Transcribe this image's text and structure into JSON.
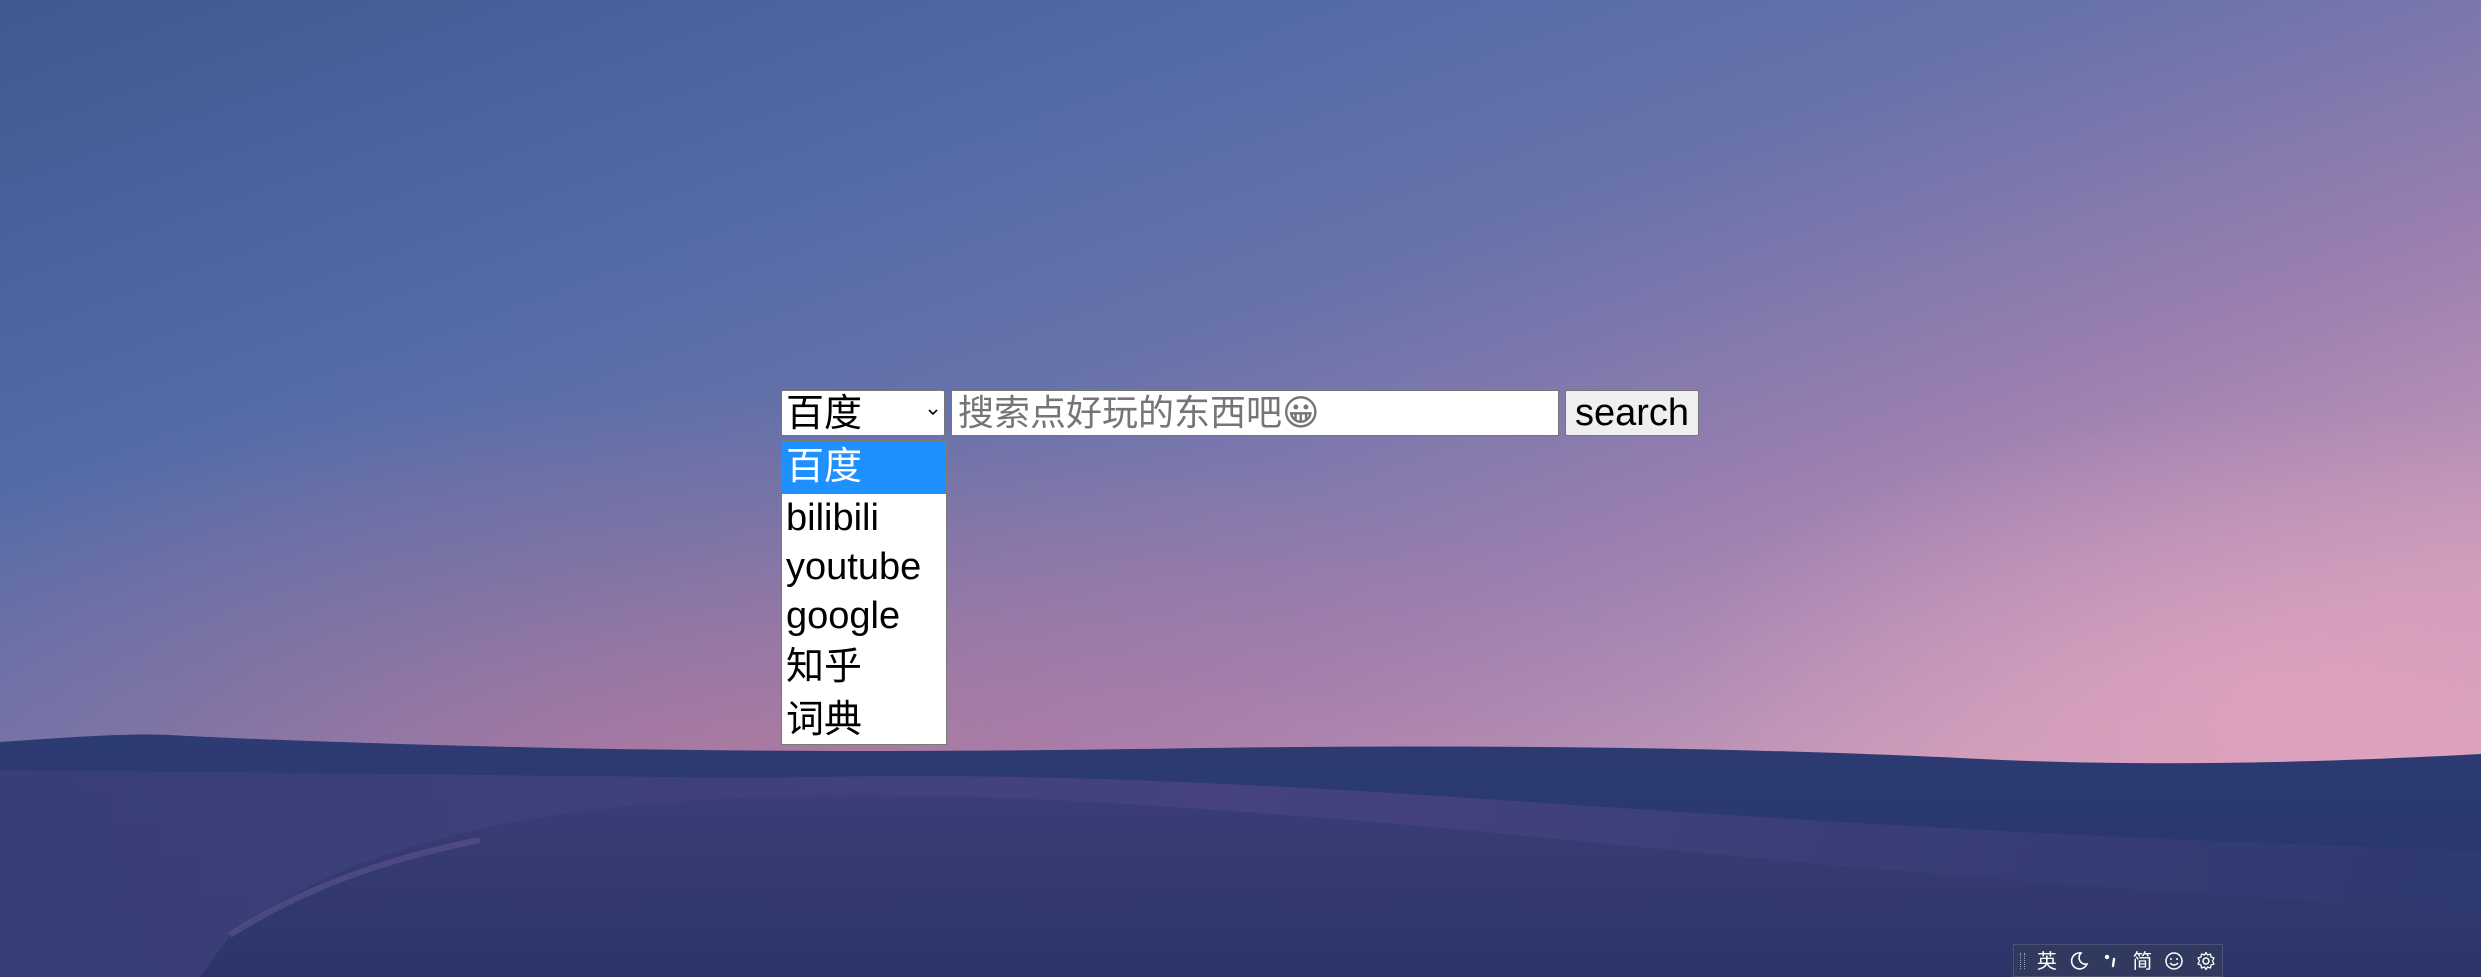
{
  "search": {
    "selected_engine": "百度",
    "placeholder": "搜索点好玩的东西吧😀",
    "button_label": "search",
    "engines": [
      "百度",
      "bilibili",
      "youtube",
      "google",
      "知乎",
      "词典"
    ]
  },
  "ime_toolbar": {
    "mode_label": "英",
    "script_label": "简",
    "icons": [
      "moon-icon",
      "punctuation-icon",
      "emoji-icon",
      "settings-icon"
    ]
  },
  "colors": {
    "selected_option_bg": "#1e90ff",
    "dune_dark": "#27356a",
    "sky_top": "#3f5a8f",
    "sky_horizon": "#e0a6bf"
  }
}
